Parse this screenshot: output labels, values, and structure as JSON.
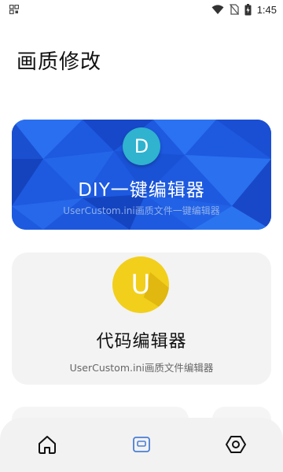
{
  "status_bar": {
    "time": "1:45",
    "icons": [
      "qr-scan-icon",
      "wifi-icon",
      "no-sim-icon",
      "battery-charging-icon"
    ]
  },
  "page": {
    "title": "画质修改"
  },
  "cards": {
    "diy": {
      "badge_letter": "D",
      "title": "DIY一键编辑器",
      "subtitle": "UserCustom.ini画质文件一键编辑器",
      "color": "#1e5ee0"
    },
    "code": {
      "badge_letter": "U",
      "title": "代码编辑器",
      "subtitle": "UserCustom.ini画质文件编辑器",
      "color": "#f2cf1b"
    }
  },
  "bottom_nav": {
    "items": [
      {
        "icon": "home-icon",
        "active": false
      },
      {
        "icon": "editor-card-icon",
        "active": true
      },
      {
        "icon": "hexagon-settings-icon",
        "active": false
      }
    ],
    "active_color": "#4a7fd4"
  }
}
